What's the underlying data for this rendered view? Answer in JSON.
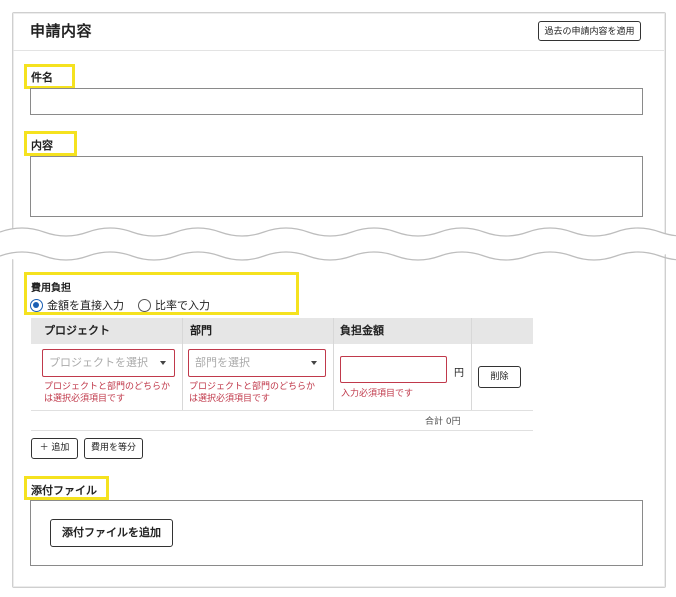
{
  "header": {
    "title": "申請内容",
    "apply_past_label": "過去の申請内容を適用"
  },
  "subject": {
    "label": "件名",
    "value": ""
  },
  "content": {
    "label": "内容",
    "value": ""
  },
  "cost": {
    "label": "費用負担",
    "options": [
      {
        "label": "金額を直接入力",
        "selected": true
      },
      {
        "label": "比率で入力",
        "selected": false
      }
    ],
    "columns": [
      "プロジェクト",
      "部門",
      "負担金額"
    ],
    "row": {
      "project_placeholder": "プロジェクトを選択",
      "project_error": [
        "プロジェクトと部門のどちらか",
        "は選択必須項目です"
      ],
      "dept_placeholder": "部門を選択",
      "dept_error": [
        "プロジェクトと部門のどちらか",
        "は選択必須項目です"
      ],
      "amount_value": "",
      "currency": "円",
      "amount_error": "入力必須項目です",
      "delete_label": "削除"
    },
    "total_label": "合計 0円",
    "add_label": "＋ 追加",
    "equal_split_label": "費用を等分"
  },
  "attachment": {
    "label": "添付ファイル",
    "add_label": "添付ファイルを追加"
  },
  "colors": {
    "highlight": "#f5e21f",
    "error": "#c0394b",
    "radio_selected": "#1a5fb4"
  }
}
